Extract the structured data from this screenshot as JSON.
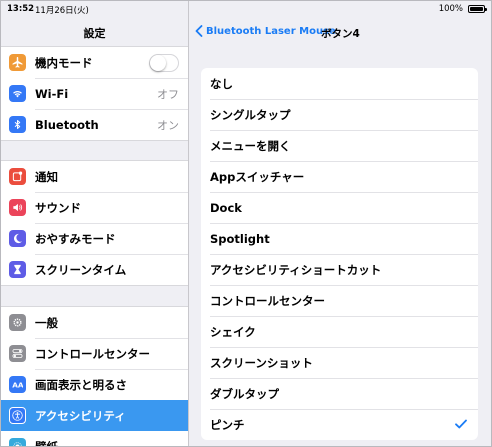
{
  "status": {
    "time": "13:52",
    "date": "11月26日(火)",
    "battery": "100%"
  },
  "sidebar": {
    "title": "設定",
    "group1": [
      {
        "label": "機内モード",
        "icon": "airplane-icon",
        "color": "#f09a37",
        "control": "toggle"
      },
      {
        "label": "Wi-Fi",
        "icon": "wifi-icon",
        "color": "#3478f6",
        "value": "オフ"
      },
      {
        "label": "Bluetooth",
        "icon": "bluetooth-icon",
        "color": "#3478f6",
        "value": "オン"
      }
    ],
    "group2": [
      {
        "label": "通知",
        "icon": "notifications-icon",
        "color": "#eb4d3d"
      },
      {
        "label": "サウンド",
        "icon": "sound-icon",
        "color": "#eb445a"
      },
      {
        "label": "おやすみモード",
        "icon": "moon-icon",
        "color": "#5e5ce6"
      },
      {
        "label": "スクリーンタイム",
        "icon": "hourglass-icon",
        "color": "#5e5ce6"
      }
    ],
    "group3": [
      {
        "label": "一般",
        "icon": "gear-icon",
        "color": "#8e8e93"
      },
      {
        "label": "コントロールセンター",
        "icon": "switches-icon",
        "color": "#8e8e93"
      },
      {
        "label": "画面表示と明るさ",
        "icon": "text-size-icon",
        "color": "#3478f6"
      },
      {
        "label": "アクセシビリティ",
        "icon": "accessibility-icon",
        "color": "#3478f6",
        "selected": true
      },
      {
        "label": "壁紙",
        "icon": "wallpaper-icon",
        "color": "#35aadc"
      }
    ]
  },
  "nav": {
    "back_label": "Bluetooth Laser Mouse",
    "title": "ボタン4"
  },
  "options": [
    {
      "label": "なし"
    },
    {
      "label": "シングルタップ"
    },
    {
      "label": "メニューを開く"
    },
    {
      "label": "Appスイッチャー"
    },
    {
      "label": "Dock"
    },
    {
      "label": "Spotlight"
    },
    {
      "label": "アクセシビリティショートカット"
    },
    {
      "label": "コントロールセンター"
    },
    {
      "label": "シェイク"
    },
    {
      "label": "スクリーンショット"
    },
    {
      "label": "ダブルタップ"
    },
    {
      "label": "ピンチ",
      "checked": true
    }
  ],
  "colors": {
    "accent": "#1a7cf5",
    "selected_row": "#3a98f0"
  }
}
